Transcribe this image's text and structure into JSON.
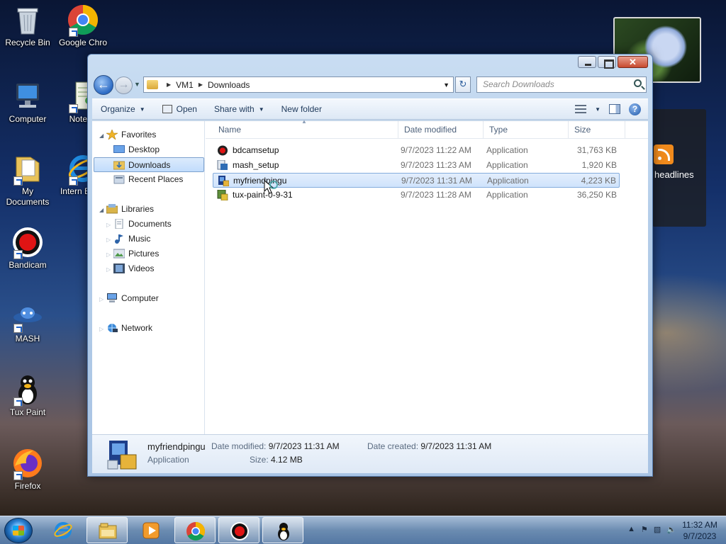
{
  "desktop": {
    "icons": [
      {
        "label": "Recycle Bin"
      },
      {
        "label": "Google Chro"
      },
      {
        "label": "Computer"
      },
      {
        "label": "Notepa"
      },
      {
        "label": "My Documents"
      },
      {
        "label": "Intern Explo"
      },
      {
        "label": "Bandicam"
      },
      {
        "label": "MASH"
      },
      {
        "label": "Tux Paint"
      },
      {
        "label": "Firefox"
      }
    ],
    "feed_gadget_label": "headlines"
  },
  "window": {
    "breadcrumb": [
      "VM1",
      "Downloads"
    ],
    "search_placeholder": "Search Downloads",
    "toolbar": {
      "organize": "Organize",
      "open": "Open",
      "share_with": "Share with",
      "new_folder": "New folder"
    },
    "nav": {
      "favorites": "Favorites",
      "desktop": "Desktop",
      "downloads": "Downloads",
      "recent_places": "Recent Places",
      "libraries": "Libraries",
      "documents": "Documents",
      "music": "Music",
      "pictures": "Pictures",
      "videos": "Videos",
      "computer": "Computer",
      "network": "Network"
    },
    "columns": {
      "name": "Name",
      "date_modified": "Date modified",
      "type": "Type",
      "size": "Size"
    },
    "files": [
      {
        "name": "bdcamsetup",
        "date": "9/7/2023 11:22 AM",
        "type": "Application",
        "size": "31,763 KB"
      },
      {
        "name": "mash_setup",
        "date": "9/7/2023 11:23 AM",
        "type": "Application",
        "size": "1,920 KB"
      },
      {
        "name": "myfriendpingu",
        "date": "9/7/2023 11:31 AM",
        "type": "Application",
        "size": "4,223 KB",
        "selected": true
      },
      {
        "name": "tux-paint-0-9-31",
        "date": "9/7/2023 11:28 AM",
        "type": "Application",
        "size": "36,250 KB"
      }
    ],
    "details": {
      "name": "myfriendpingu",
      "type": "Application",
      "date_modified_label": "Date modified:",
      "date_modified": "9/7/2023 11:31 AM",
      "date_created_label": "Date created:",
      "date_created": "9/7/2023 11:31 AM",
      "size_label": "Size:",
      "size": "4.12 MB"
    }
  },
  "taskbar": {
    "clock_time": "11:32 AM",
    "clock_date": "9/7/2023",
    "pinned": [
      "ie-icon",
      "explorer-icon",
      "media-player-icon",
      "chrome-icon",
      "bandicam-icon",
      "tux-paint-icon"
    ]
  }
}
